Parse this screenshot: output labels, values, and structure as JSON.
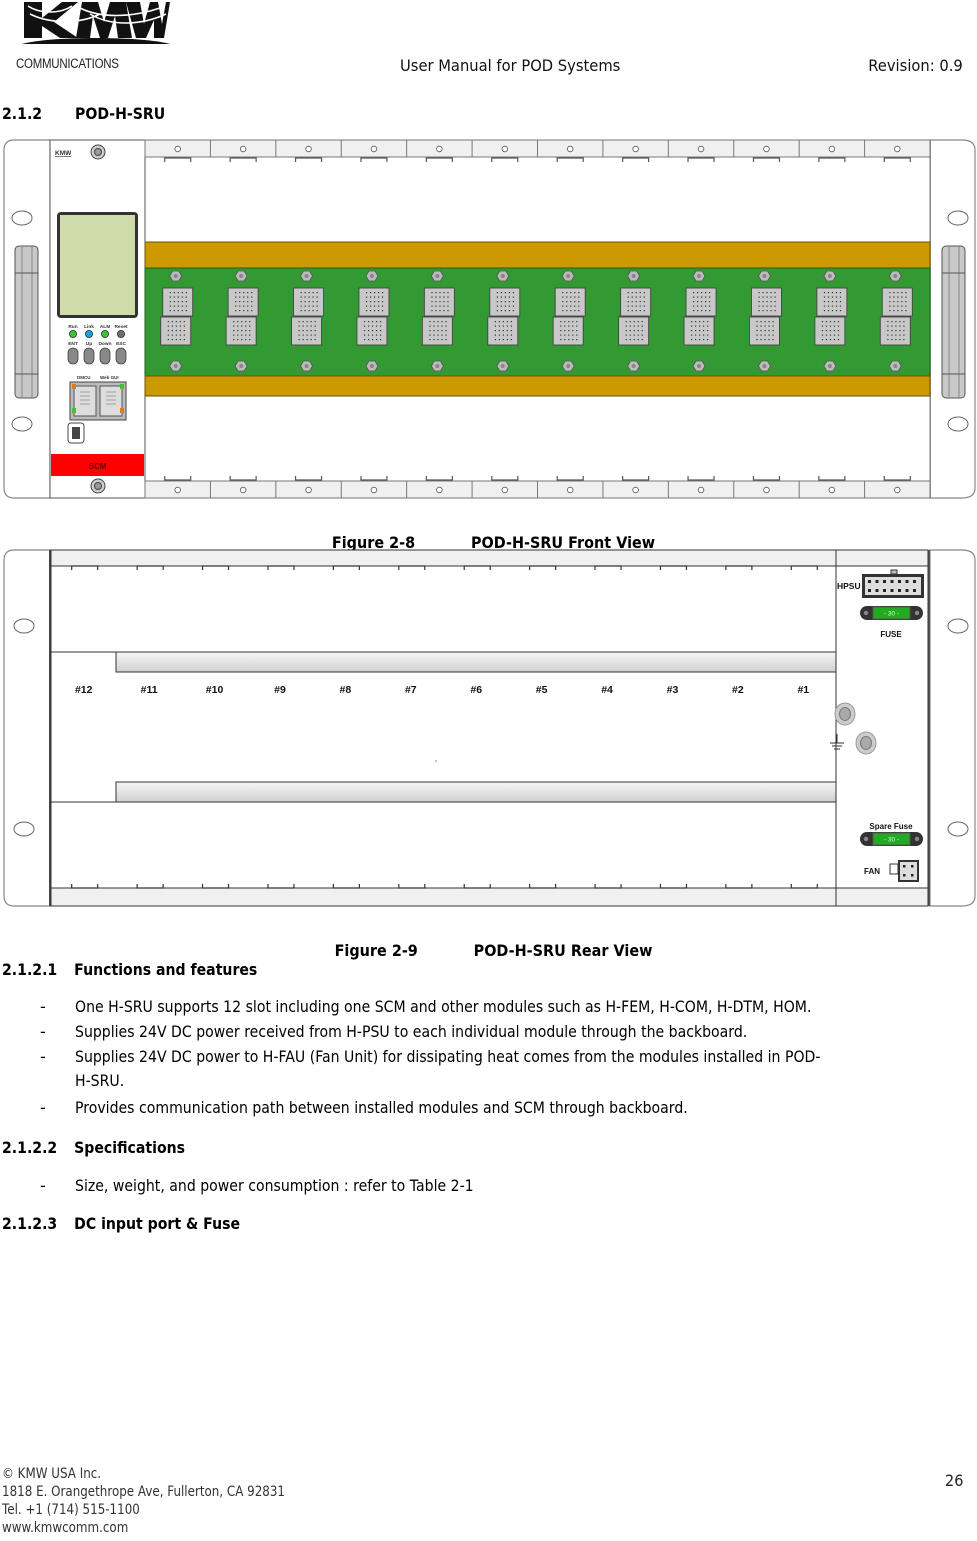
{
  "header": {
    "logo_text_main": "KMW",
    "logo_text_sub": "COMMUNICATIONS",
    "title": "User Manual for POD Systems",
    "revision": "Revision: 0.9"
  },
  "section": {
    "number": "2.1.2",
    "title": "POD-H-SRU"
  },
  "figure_front": {
    "number": "Figure 2-8",
    "title": "POD-H-SRU Front View",
    "scm_panel": {
      "brand": "KMW",
      "label": "SCM",
      "leds": [
        {
          "label": "Run",
          "color": "#3cc43c"
        },
        {
          "label": "Link",
          "color": "#1aa0e6"
        },
        {
          "label": "ALM",
          "color": "#3cc43c"
        },
        {
          "label": "Reset",
          "color": "#6e6e6e"
        }
      ],
      "buttons": [
        "ENT",
        "Up",
        "Down",
        "ESC"
      ],
      "ports": [
        "DMCU",
        "Web GUI"
      ],
      "label_color": "#ff0000",
      "lcd_color": "#cfdcaa"
    },
    "slot_count": 12,
    "backplane_color": "#339933",
    "rail_color": "#cc9900"
  },
  "figure_rear": {
    "number": "Figure 2-9",
    "title": "POD-H-SRU Rear View",
    "slot_labels": [
      "#12",
      "#11",
      "#10",
      "#9",
      "#8",
      "#7",
      "#6",
      "#5",
      "#4",
      "#3",
      "#2",
      "#1"
    ],
    "hpsu_label": "HPSU",
    "fuse_label": "FUSE",
    "fuse_value": "- 30 -",
    "spare_fuse_label": "Spare Fuse",
    "spare_fuse_value": "- 30 -",
    "fan_label": "FAN",
    "fuse_color": "#22aa22"
  },
  "subsections": [
    {
      "number": "2.1.2.1",
      "title": "Functions and features",
      "bullets": [
        "One H-SRU supports 12 slot including one SCM and other modules such as H-FEM, H-COM, H-DTM, HOM.",
        "Supplies 24V DC power received from H-PSU to each individual module through the backboard.",
        "Supplies 24V DC power to H-FAU (Fan Unit) for dissipating heat comes from the modules installed in POD-",
        "H-SRU.",
        "Provides communication path between installed modules and SCM through backboard."
      ]
    },
    {
      "number": "2.1.2.2",
      "title": "Specifications",
      "bullets": [
        "Size, weight, and power consumption : refer to Table 2-1"
      ]
    },
    {
      "number": "2.1.2.3",
      "title": "DC input port & Fuse",
      "bullets": []
    }
  ],
  "bullet_marker": "-",
  "footer": {
    "copyright": "© KMW USA Inc.",
    "address": "1818 E. Orangethrope Ave, Fullerton, CA 92831",
    "phone": "Tel. +1 (714) 515-1100",
    "website": "www.kmwcomm.com",
    "page_number": "26"
  }
}
